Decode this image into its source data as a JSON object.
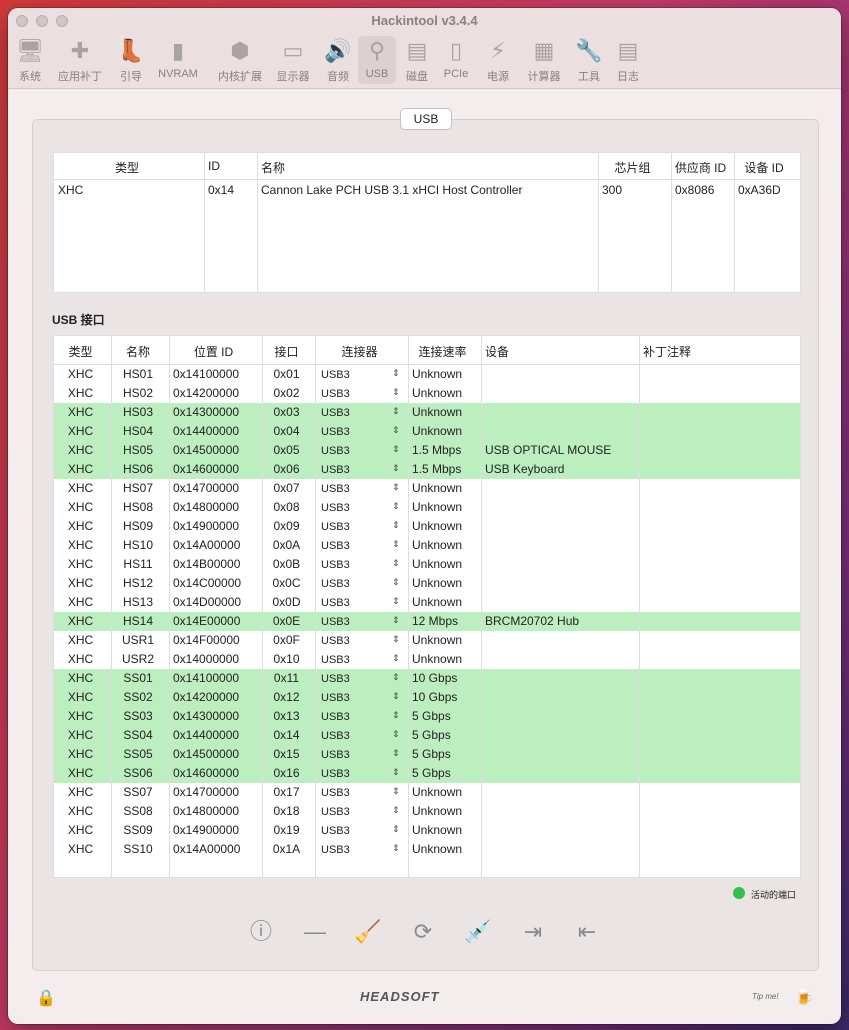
{
  "window": {
    "title": "Hackintool v3.4.4"
  },
  "toolbar": [
    {
      "label": "系统",
      "icon": "system-icon",
      "glyph": "🖥"
    },
    {
      "label": "应用补丁",
      "icon": "bandage-icon",
      "glyph": "✚"
    },
    {
      "label": "引导",
      "icon": "boot-icon",
      "glyph": "👢"
    },
    {
      "label": "NVRAM",
      "icon": "nvram-icon",
      "glyph": "▮"
    },
    {
      "label": "内核扩展",
      "icon": "kext-icon",
      "glyph": "⬢"
    },
    {
      "label": "显示器",
      "icon": "display-icon",
      "glyph": "▭"
    },
    {
      "label": "音频",
      "icon": "speaker-icon",
      "glyph": "🔊"
    },
    {
      "label": "USB",
      "icon": "usb-icon",
      "glyph": "⚲"
    },
    {
      "label": "磁盘",
      "icon": "disk-icon",
      "glyph": "▤"
    },
    {
      "label": "PCIe",
      "icon": "pcie-icon",
      "glyph": "▯"
    },
    {
      "label": "电源",
      "icon": "power-icon",
      "glyph": "⚡"
    },
    {
      "label": "计算器",
      "icon": "calculator-icon",
      "glyph": "▦"
    },
    {
      "label": "工具",
      "icon": "wrench-icon",
      "glyph": "🔧"
    },
    {
      "label": "日志",
      "icon": "log-icon",
      "glyph": "▤"
    }
  ],
  "tab": {
    "label": "USB"
  },
  "controllers": {
    "headers": [
      "类型",
      "ID",
      "名称",
      "芯片组",
      "供应商 ID",
      "设备 ID"
    ],
    "rows": [
      [
        "XHC",
        "0x14",
        "Cannon Lake PCH USB 3.1 xHCI Host Controller",
        "300",
        "0x8086",
        "0xA36D"
      ]
    ]
  },
  "ports_section": {
    "label": "USB 接口"
  },
  "ports": {
    "headers": [
      "类型",
      "名称",
      "位置 ID",
      "接口",
      "连接器",
      "连接速率",
      "设备",
      "补丁注释"
    ],
    "rows": [
      {
        "type": "XHC",
        "name": "HS01",
        "loc": "0x14100000",
        "port": "0x01",
        "conn": "USB3",
        "speed": "Unknown",
        "device": "",
        "note": "",
        "active": false
      },
      {
        "type": "XHC",
        "name": "HS02",
        "loc": "0x14200000",
        "port": "0x02",
        "conn": "USB3",
        "speed": "Unknown",
        "device": "",
        "note": "",
        "active": false
      },
      {
        "type": "XHC",
        "name": "HS03",
        "loc": "0x14300000",
        "port": "0x03",
        "conn": "USB3",
        "speed": "Unknown",
        "device": "",
        "note": "",
        "active": true
      },
      {
        "type": "XHC",
        "name": "HS04",
        "loc": "0x14400000",
        "port": "0x04",
        "conn": "USB3",
        "speed": "Unknown",
        "device": "",
        "note": "",
        "active": true
      },
      {
        "type": "XHC",
        "name": "HS05",
        "loc": "0x14500000",
        "port": "0x05",
        "conn": "USB3",
        "speed": "1.5 Mbps",
        "device": " USB OPTICAL MOUSE",
        "note": "",
        "active": true
      },
      {
        "type": "XHC",
        "name": "HS06",
        "loc": "0x14600000",
        "port": "0x06",
        "conn": "USB3",
        "speed": "1.5 Mbps",
        "device": "USB Keyboard",
        "note": "",
        "active": true
      },
      {
        "type": "XHC",
        "name": "HS07",
        "loc": "0x14700000",
        "port": "0x07",
        "conn": "USB3",
        "speed": "Unknown",
        "device": "",
        "note": "",
        "active": false
      },
      {
        "type": "XHC",
        "name": "HS08",
        "loc": "0x14800000",
        "port": "0x08",
        "conn": "USB3",
        "speed": "Unknown",
        "device": "",
        "note": "",
        "active": false
      },
      {
        "type": "XHC",
        "name": "HS09",
        "loc": "0x14900000",
        "port": "0x09",
        "conn": "USB3",
        "speed": "Unknown",
        "device": "",
        "note": "",
        "active": false
      },
      {
        "type": "XHC",
        "name": "HS10",
        "loc": "0x14A00000",
        "port": "0x0A",
        "conn": "USB3",
        "speed": "Unknown",
        "device": "",
        "note": "",
        "active": false
      },
      {
        "type": "XHC",
        "name": "HS11",
        "loc": "0x14B00000",
        "port": "0x0B",
        "conn": "USB3",
        "speed": "Unknown",
        "device": "",
        "note": "",
        "active": false
      },
      {
        "type": "XHC",
        "name": "HS12",
        "loc": "0x14C00000",
        "port": "0x0C",
        "conn": "USB3",
        "speed": "Unknown",
        "device": "",
        "note": "",
        "active": false
      },
      {
        "type": "XHC",
        "name": "HS13",
        "loc": "0x14D00000",
        "port": "0x0D",
        "conn": "USB3",
        "speed": "Unknown",
        "device": "",
        "note": "",
        "active": false
      },
      {
        "type": "XHC",
        "name": "HS14",
        "loc": "0x14E00000",
        "port": "0x0E",
        "conn": "USB3",
        "speed": "12 Mbps",
        "device": "BRCM20702 Hub",
        "note": "",
        "active": true
      },
      {
        "type": "XHC",
        "name": "USR1",
        "loc": "0x14F00000",
        "port": "0x0F",
        "conn": "USB3",
        "speed": "Unknown",
        "device": "",
        "note": "",
        "active": false
      },
      {
        "type": "XHC",
        "name": "USR2",
        "loc": "0x14000000",
        "port": "0x10",
        "conn": "USB3",
        "speed": "Unknown",
        "device": "",
        "note": "",
        "active": false
      },
      {
        "type": "XHC",
        "name": "SS01",
        "loc": "0x14100000",
        "port": "0x11",
        "conn": "USB3",
        "speed": "10 Gbps",
        "device": "",
        "note": "",
        "active": true
      },
      {
        "type": "XHC",
        "name": "SS02",
        "loc": "0x14200000",
        "port": "0x12",
        "conn": "USB3",
        "speed": "10 Gbps",
        "device": "",
        "note": "",
        "active": true
      },
      {
        "type": "XHC",
        "name": "SS03",
        "loc": "0x14300000",
        "port": "0x13",
        "conn": "USB3",
        "speed": "5 Gbps",
        "device": "",
        "note": "",
        "active": true
      },
      {
        "type": "XHC",
        "name": "SS04",
        "loc": "0x14400000",
        "port": "0x14",
        "conn": "USB3",
        "speed": "5 Gbps",
        "device": "",
        "note": "",
        "active": true
      },
      {
        "type": "XHC",
        "name": "SS05",
        "loc": "0x14500000",
        "port": "0x15",
        "conn": "USB3",
        "speed": "5 Gbps",
        "device": "",
        "note": "",
        "active": true
      },
      {
        "type": "XHC",
        "name": "SS06",
        "loc": "0x14600000",
        "port": "0x16",
        "conn": "USB3",
        "speed": "5 Gbps",
        "device": "",
        "note": "",
        "active": true
      },
      {
        "type": "XHC",
        "name": "SS07",
        "loc": "0x14700000",
        "port": "0x17",
        "conn": "USB3",
        "speed": "Unknown",
        "device": "",
        "note": "",
        "active": false
      },
      {
        "type": "XHC",
        "name": "SS08",
        "loc": "0x14800000",
        "port": "0x18",
        "conn": "USB3",
        "speed": "Unknown",
        "device": "",
        "note": "",
        "active": false
      },
      {
        "type": "XHC",
        "name": "SS09",
        "loc": "0x14900000",
        "port": "0x19",
        "conn": "USB3",
        "speed": "Unknown",
        "device": "",
        "note": "",
        "active": false
      },
      {
        "type": "XHC",
        "name": "SS10",
        "loc": "0x14A00000",
        "port": "0x1A",
        "conn": "USB3",
        "speed": "Unknown",
        "device": "",
        "note": "",
        "active": false
      }
    ]
  },
  "legend": {
    "label": "活动的端口",
    "color": "#2ec24a"
  },
  "colors": {
    "active_row": "#bdeebf"
  },
  "bottom_buttons": [
    {
      "icon": "info-icon",
      "glyph": "ⓘ"
    },
    {
      "icon": "minus-icon",
      "glyph": "—"
    },
    {
      "icon": "broom-icon",
      "glyph": "🧹"
    },
    {
      "icon": "refresh-icon",
      "glyph": "⟳"
    },
    {
      "icon": "injector-icon",
      "glyph": "💉"
    },
    {
      "icon": "import-icon",
      "glyph": "⇥"
    },
    {
      "icon": "export-icon",
      "glyph": "⇤"
    }
  ],
  "footer": {
    "logo": "HEADSOFT",
    "tip": "Tip me!",
    "lock_glyph": "🔒",
    "beer_glyph": "🍺"
  }
}
